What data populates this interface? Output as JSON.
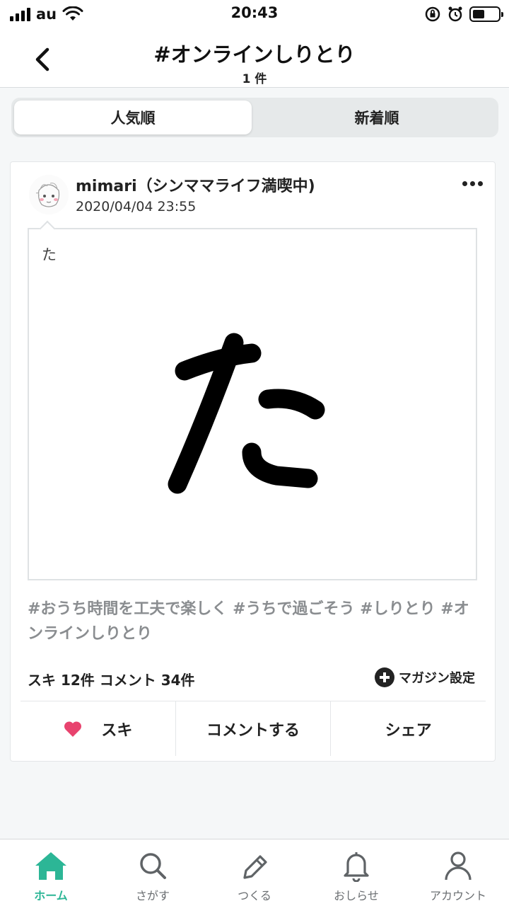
{
  "status_bar": {
    "carrier": "au",
    "time": "20:43"
  },
  "header": {
    "title": "#オンラインしりとり",
    "count": "1 件"
  },
  "segment": {
    "popular": "人気順",
    "newest": "新着順"
  },
  "post": {
    "author": "mimari（シンママライフ満喫中)",
    "date": "2020/04/04 23:55",
    "text": "た",
    "hashtags": "#おうち時間を工夫で楽しく #うちで過ごそう #しりとり #オンラインしりとり",
    "stats": "スキ 12件 コメント 34件",
    "magazine_label": "マガジン設定",
    "actions": {
      "like": "スキ",
      "comment": "コメントする",
      "share": "シェア"
    }
  },
  "tabs": [
    {
      "label": "ホーム",
      "icon": "home-icon"
    },
    {
      "label": "さがす",
      "icon": "search-icon"
    },
    {
      "label": "つくる",
      "icon": "pencil-icon"
    },
    {
      "label": "おしらせ",
      "icon": "bell-icon"
    },
    {
      "label": "アカウント",
      "icon": "account-icon"
    }
  ],
  "colors": {
    "accent": "#2cb696",
    "like": "#e8436e"
  }
}
